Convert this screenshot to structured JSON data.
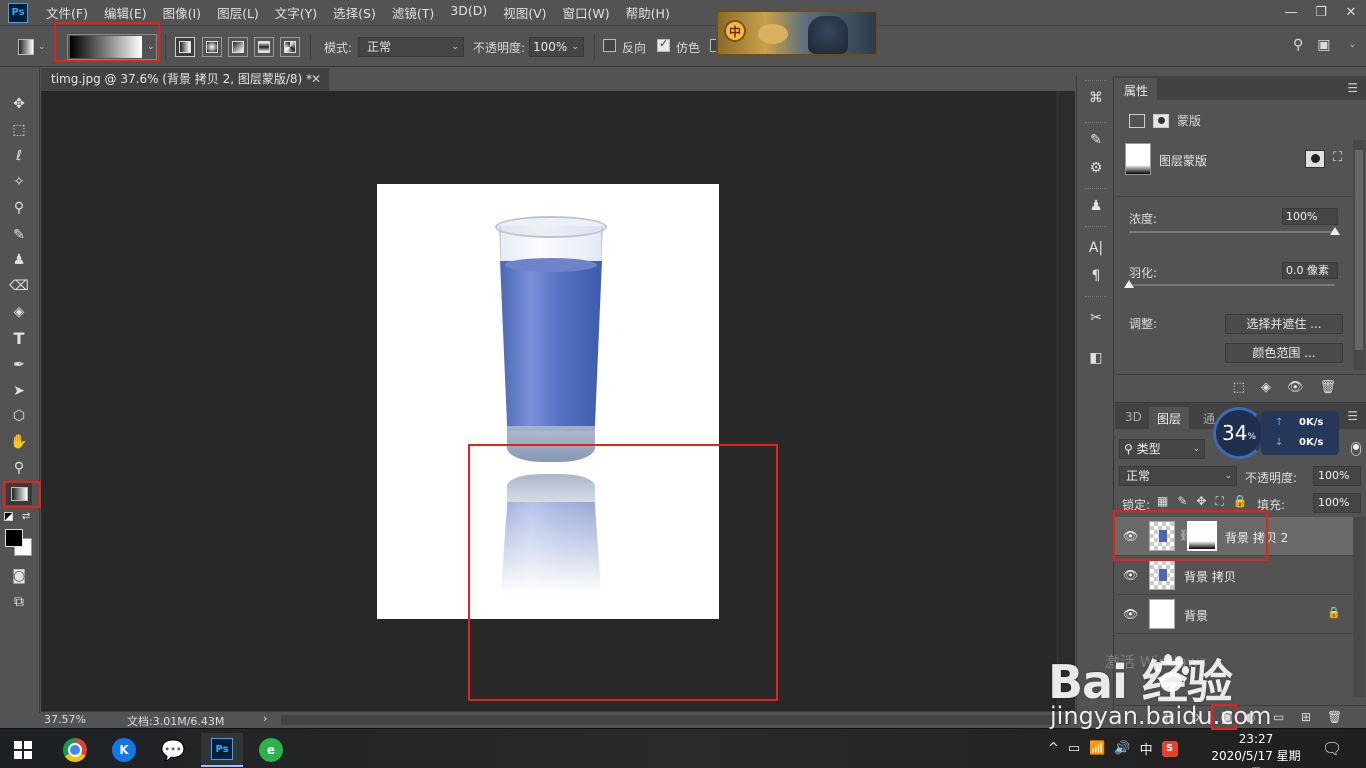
{
  "app": {
    "logo": "Ps"
  },
  "menu": [
    "文件(F)",
    "编辑(E)",
    "图像(I)",
    "图层(L)",
    "文字(Y)",
    "选择(S)",
    "滤镜(T)",
    "3D(D)",
    "视图(V)",
    "窗口(W)",
    "帮助(H)"
  ],
  "banner": {
    "badge": "中"
  },
  "window_controls": {
    "minimize": "—",
    "restore": "❐",
    "close": "✕"
  },
  "options": {
    "mode_label": "模式:",
    "mode_value": "正常",
    "opacity_label": "不透明度:",
    "opacity_value": "100%",
    "reverse_label": "反向",
    "dither_label": "仿色",
    "reverse_checked": false,
    "dither_checked": true
  },
  "icons": {
    "move": "✥",
    "marquee": "⬚",
    "lasso": "ℓ",
    "magic_wand": "✧",
    "eyedropper": "⚲",
    "brush": "✎",
    "stamp": "♟",
    "eraser": "⌫",
    "paint_bucket": "◈",
    "type": "T",
    "pen": "✒",
    "path_select": "➤",
    "shape": "⬡",
    "hand": "✋",
    "zoom": "⚲",
    "quick_mask": "◙",
    "screen_mode": "⧉",
    "search": "⚲",
    "workspace": "▣",
    "swap": "⇄",
    "eye": "👁",
    "chain": "⛓",
    "lock": "🔒",
    "menu": "☰",
    "chevron": "⌄"
  },
  "document": {
    "tab_title": "timg.jpg @ 37.6% (背景 拷贝 2, 图层蒙版/8) *",
    "close": "✕",
    "zoom": "37.57%",
    "doc_size": "文档:3.01M/6.43M",
    "status_arrow": "›"
  },
  "dock": [
    "⌘",
    "✎",
    "⚙",
    "♟",
    "A|",
    "¶",
    "✂",
    "◧"
  ],
  "properties": {
    "tab": "属性",
    "mask_label": "蒙版",
    "type_label": "图层蒙版",
    "density_label": "浓度:",
    "density_value": "100%",
    "density_fraction": 1.0,
    "feather_label": "羽化:",
    "feather_value": "0.0 像素",
    "feather_fraction": 0.0,
    "adjust_label": "调整:",
    "select_mask_btn": "选择并遮住 ...",
    "color_range_btn": "颜色范围 ...",
    "footer_icons": [
      "⬚",
      "◈",
      "👁",
      "🗑"
    ]
  },
  "layers": {
    "tabs": [
      "3D",
      "图层",
      "通"
    ],
    "filter_value": "类型",
    "blend_value": "正常",
    "opacity_label": "不透明度:",
    "opacity_value": "100%",
    "lock_label": "锁定:",
    "lock_icons": [
      "▦",
      "✎",
      "✥",
      "⛶",
      "🔒"
    ],
    "fill_label": "填充:",
    "fill_value": "100%",
    "items": [
      {
        "name": "背景 拷贝 2",
        "selected": true
      },
      {
        "name": "背景 拷贝",
        "selected": false
      },
      {
        "name": "背景",
        "selected": false
      }
    ],
    "watermark": "激活 Windows",
    "footer_icons": [
      "⛓",
      "fx",
      "◙",
      "◐",
      "▭",
      "⊞",
      "🗑"
    ]
  },
  "net_widget": {
    "percent": "34",
    "percent_unit": "%",
    "up_arrow": "↑",
    "down_arrow": "↓",
    "up": "0K/s",
    "down": "0K/s"
  },
  "watermark": {
    "logo": "Bai  经验",
    "url": "jingyan.baidu.com"
  },
  "taskbar": {
    "kugou_letter": "K",
    "wechat_glyph": "💬",
    "ps_label": "Ps",
    "green_glyph": "e",
    "tray": [
      "^",
      "▭",
      "📶",
      "🔊",
      "中"
    ],
    "sogou": "S",
    "time": "23:27",
    "date": "2020/5/17 星期日",
    "notify": "🗨"
  }
}
